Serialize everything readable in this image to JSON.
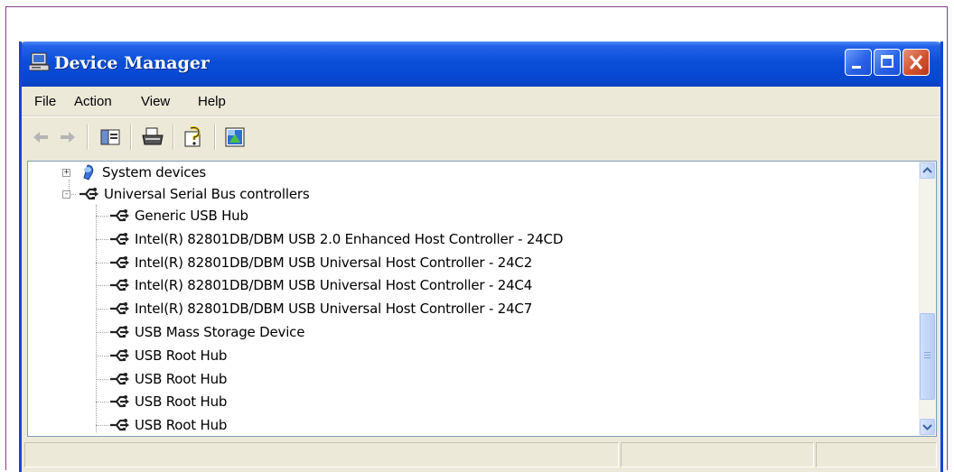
{
  "window": {
    "title": "Device Manager",
    "app_icon": "computer-icon"
  },
  "menu": [
    "File",
    "Action",
    "View",
    "Help"
  ],
  "toolbar": {
    "buttons": [
      "back-arrow-icon",
      "forward-arrow-icon",
      "show-hide-console-tree-icon",
      "print-icon",
      "help-icon",
      "properties-icon"
    ]
  },
  "tree": {
    "system_devices": {
      "label": "System devices",
      "icon": "system-devices-icon",
      "expander": "+"
    },
    "usb_controllers": {
      "label": "Universal Serial Bus controllers",
      "icon": "usb-icon",
      "expander": "-"
    },
    "usb_children": [
      "Generic USB Hub",
      "Intel(R) 82801DB/DBM USB 2.0 Enhanced Host Controller - 24CD",
      "Intel(R) 82801DB/DBM USB Universal Host Controller - 24C2",
      "Intel(R) 82801DB/DBM USB Universal Host Controller - 24C4",
      "Intel(R) 82801DB/DBM USB Universal Host Controller - 24C7",
      "USB Mass Storage Device",
      "USB Root Hub",
      "USB Root Hub",
      "USB Root Hub",
      "USB Root Hub"
    ]
  },
  "colors": {
    "titlebar": "#0a4fd9",
    "close_button": "#d2522f",
    "chrome": "#ece9d8"
  }
}
